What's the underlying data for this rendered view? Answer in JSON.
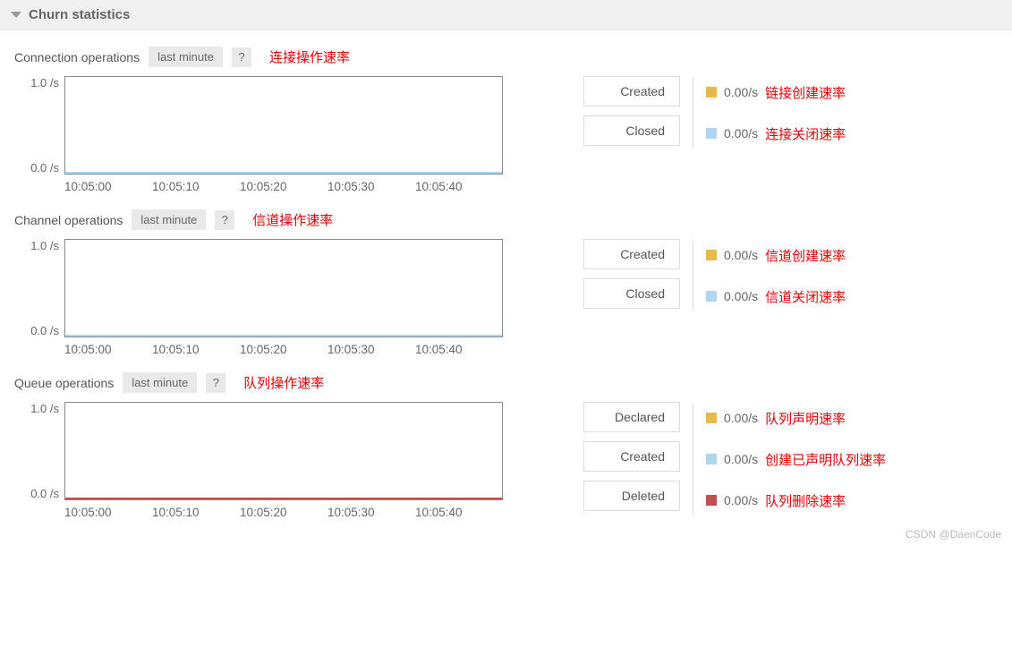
{
  "header": {
    "title": "Churn statistics"
  },
  "watermark": "CSDN @DaenCode",
  "time_axis": [
    "10:05:00",
    "10:05:10",
    "10:05:20",
    "10:05:30",
    "10:05:40"
  ],
  "y_labels": {
    "top": "1.0 /s",
    "bottom": "0.0 /s"
  },
  "common": {
    "range_label": "last minute",
    "help": "?"
  },
  "sections": [
    {
      "key": "connection",
      "title": "Connection operations",
      "annot": "连接操作速率",
      "line_color": "blue",
      "legend": [
        {
          "label": "Created",
          "swatch": "orange",
          "rate": "0.00/s",
          "annot": "链接创建速率"
        },
        {
          "label": "Closed",
          "swatch": "blue",
          "rate": "0.00/s",
          "annot": "连接关闭速率"
        }
      ]
    },
    {
      "key": "channel",
      "title": "Channel operations",
      "annot": "信道操作速率",
      "line_color": "blue",
      "legend": [
        {
          "label": "Created",
          "swatch": "orange",
          "rate": "0.00/s",
          "annot": "信道创建速率"
        },
        {
          "label": "Closed",
          "swatch": "blue",
          "rate": "0.00/s",
          "annot": "信道关闭速率"
        }
      ]
    },
    {
      "key": "queue",
      "title": "Queue operations",
      "annot": "队列操作速率",
      "line_color": "red",
      "legend": [
        {
          "label": "Declared",
          "swatch": "orange",
          "rate": "0.00/s",
          "annot": "队列声明速率"
        },
        {
          "label": "Created",
          "swatch": "blue",
          "rate": "0.00/s",
          "annot": "创建已声明队列速率"
        },
        {
          "label": "Deleted",
          "swatch": "red",
          "rate": "0.00/s",
          "annot": "队列删除速率"
        }
      ]
    }
  ],
  "chart_data": [
    {
      "type": "line",
      "title": "Connection operations",
      "x": [
        "10:05:00",
        "10:05:10",
        "10:05:20",
        "10:05:30",
        "10:05:40"
      ],
      "xlabel": "",
      "ylabel": "/s",
      "ylim": [
        0,
        1.0
      ],
      "series": [
        {
          "name": "Created",
          "values": [
            0,
            0,
            0,
            0,
            0
          ]
        },
        {
          "name": "Closed",
          "values": [
            0,
            0,
            0,
            0,
            0
          ]
        }
      ]
    },
    {
      "type": "line",
      "title": "Channel operations",
      "x": [
        "10:05:00",
        "10:05:10",
        "10:05:20",
        "10:05:30",
        "10:05:40"
      ],
      "xlabel": "",
      "ylabel": "/s",
      "ylim": [
        0,
        1.0
      ],
      "series": [
        {
          "name": "Created",
          "values": [
            0,
            0,
            0,
            0,
            0
          ]
        },
        {
          "name": "Closed",
          "values": [
            0,
            0,
            0,
            0,
            0
          ]
        }
      ]
    },
    {
      "type": "line",
      "title": "Queue operations",
      "x": [
        "10:05:00",
        "10:05:10",
        "10:05:20",
        "10:05:30",
        "10:05:40"
      ],
      "xlabel": "",
      "ylabel": "/s",
      "ylim": [
        0,
        1.0
      ],
      "series": [
        {
          "name": "Declared",
          "values": [
            0,
            0,
            0,
            0,
            0
          ]
        },
        {
          "name": "Created",
          "values": [
            0,
            0,
            0,
            0,
            0
          ]
        },
        {
          "name": "Deleted",
          "values": [
            0,
            0,
            0,
            0,
            0
          ]
        }
      ]
    }
  ]
}
